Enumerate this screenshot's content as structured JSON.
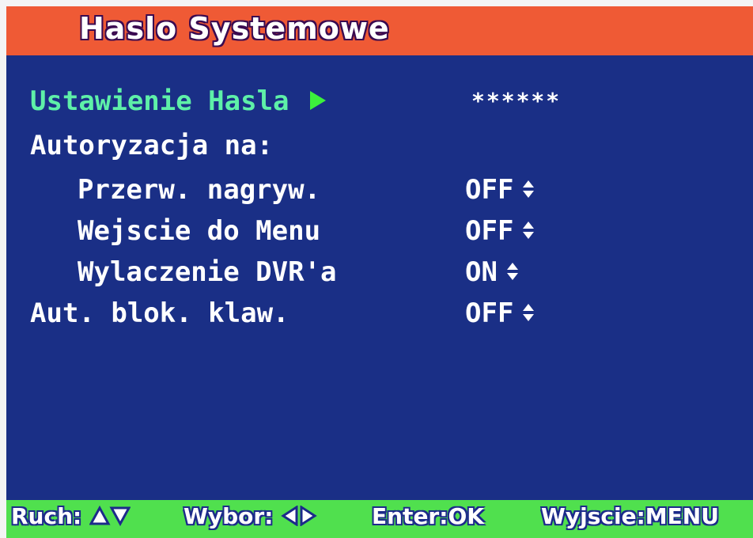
{
  "title": "Haslo Systemowe",
  "colors": {
    "background": "#1a2f86",
    "title_bar": "#ef5a35",
    "footer": "#50e04e",
    "selected_text": "#5ef0a8",
    "text": "#ffffff"
  },
  "menu": {
    "password": {
      "label": "Ustawienie Hasla",
      "value": "******",
      "selected": true,
      "icon": "right-arrow-icon"
    },
    "auth_header": {
      "label": "Autoryzacja na:"
    },
    "items": [
      {
        "label": "Przerw. nagryw.",
        "value": "OFF"
      },
      {
        "label": "Wejscie do Menu",
        "value": "OFF"
      },
      {
        "label": "Wylaczenie DVR'a",
        "value": "ON"
      }
    ],
    "keylock": {
      "label": "Aut. blok. klaw.",
      "value": "OFF"
    }
  },
  "footer": {
    "move_label": "Ruch:",
    "select_label": "Wybor:",
    "enter_label": "Enter:OK",
    "exit_label": "Wyjscie:MENU"
  }
}
